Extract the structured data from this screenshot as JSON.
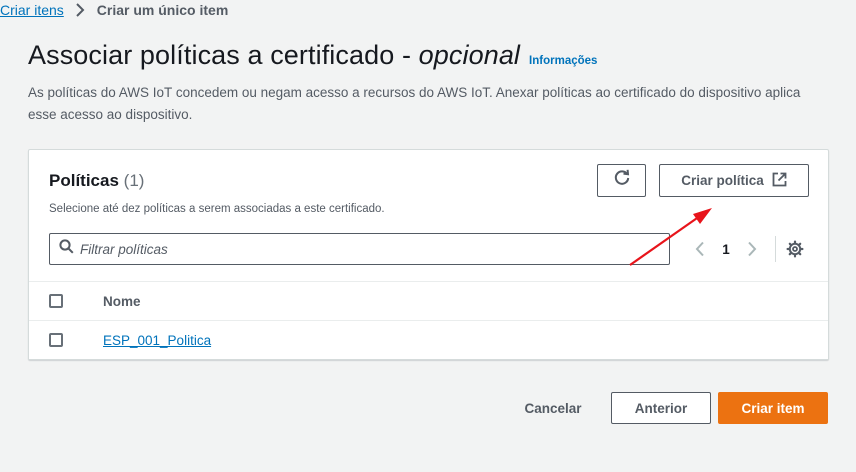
{
  "breadcrumb": {
    "parent": "Criar itens",
    "current": "Criar um único item"
  },
  "header": {
    "title_main": "Associar políticas a certificado - ",
    "title_optional": "opcional",
    "info_link": "Informações",
    "description": "As políticas do AWS IoT concedem ou negam acesso a recursos do AWS IoT. Anexar políticas ao certificado do dispositivo aplica esse acesso ao dispositivo."
  },
  "policies_panel": {
    "title": "Políticas",
    "count": "(1)",
    "subtitle": "Selecione até dez políticas a serem associadas a este certificado.",
    "refresh_icon": "refresh-icon",
    "create_policy_label": "Criar política",
    "create_policy_icon": "external-link-icon",
    "filter_placeholder": "Filtrar políticas",
    "pagination": {
      "current_page": "1"
    },
    "table": {
      "columns": [
        "Nome"
      ],
      "rows": [
        {
          "name": "ESP_001_Politica"
        }
      ]
    }
  },
  "footer": {
    "cancel_label": "Cancelar",
    "previous_label": "Anterior",
    "submit_label": "Criar item"
  },
  "colors": {
    "primary": "#ec7211",
    "link": "#0073bb",
    "annotation_arrow": "#e8141b"
  }
}
